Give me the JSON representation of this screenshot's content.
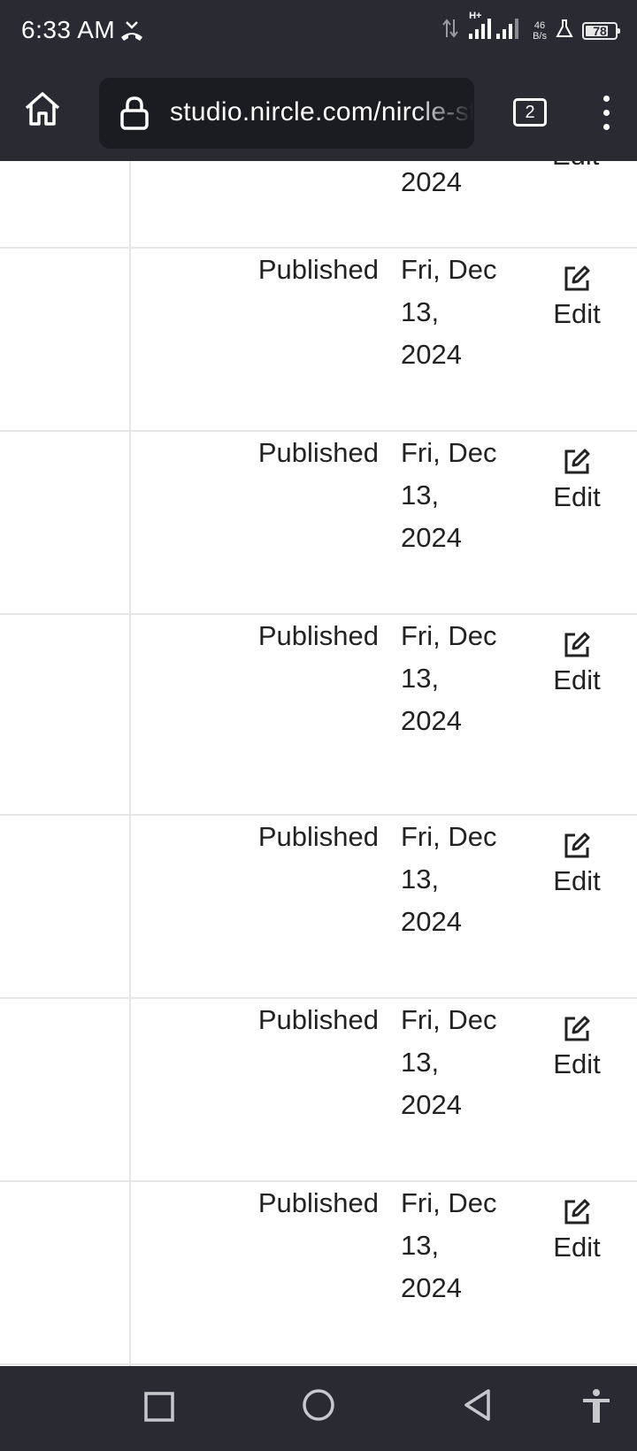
{
  "status_bar": {
    "time": "6:33 AM",
    "network_type": "H+",
    "net_speed_value": "46",
    "net_speed_unit": "B/s",
    "battery_level": "78",
    "battery_fraction": 0.78
  },
  "browser": {
    "url": "studio.nircle.com/nircle-st",
    "tab_count": "2"
  },
  "table": {
    "partial_row": {
      "date_year": "2024",
      "edit_label": "Edit"
    },
    "rows": [
      {
        "status": "Published",
        "date_line1": "Fri, Dec",
        "date_line2": "13,",
        "date_line3": "2024",
        "edit_label": "Edit"
      },
      {
        "status": "Published",
        "date_line1": "Fri, Dec",
        "date_line2": "13,",
        "date_line3": "2024",
        "edit_label": "Edit"
      },
      {
        "status": "Published",
        "date_line1": "Fri, Dec",
        "date_line2": "13,",
        "date_line3": "2024",
        "edit_label": "Edit"
      },
      {
        "status": "Published",
        "date_line1": "Fri, Dec",
        "date_line2": "13,",
        "date_line3": "2024",
        "edit_label": "Edit"
      },
      {
        "status": "Published",
        "date_line1": "Fri, Dec",
        "date_line2": "13,",
        "date_line3": "2024",
        "edit_label": "Edit"
      },
      {
        "status": "Published",
        "date_line1": "Fri, Dec",
        "date_line2": "13,",
        "date_line3": "2024",
        "edit_label": "Edit"
      }
    ]
  },
  "nav_bar": {
    "icons": [
      "recents-icon",
      "home-icon",
      "back-icon",
      "accessibility-icon"
    ]
  }
}
